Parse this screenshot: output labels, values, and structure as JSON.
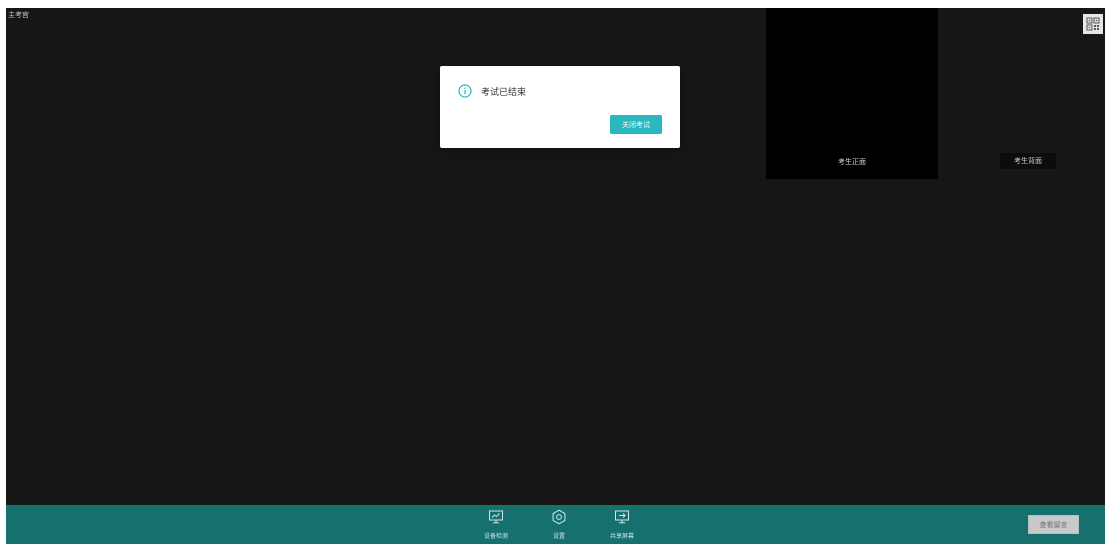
{
  "main_video": {
    "label": "主考官"
  },
  "videos": {
    "front_label": "考生正面",
    "back_label": "考生背面"
  },
  "qr": {
    "icon": "qrcode-icon"
  },
  "dialog": {
    "message": "考试已结束",
    "icon": "info-icon",
    "button_label": "关闭考试"
  },
  "toolbar": {
    "items": [
      {
        "label": "设备检测",
        "icon": "monitor-chart-icon"
      },
      {
        "label": "设置",
        "icon": "gear-icon"
      },
      {
        "label": "共享屏幕",
        "icon": "screen-share-icon"
      }
    ],
    "view_room_label": "查看留言"
  },
  "colors": {
    "background": "#161616",
    "toolbar": "#15706e",
    "accent": "#2ab7c0"
  }
}
